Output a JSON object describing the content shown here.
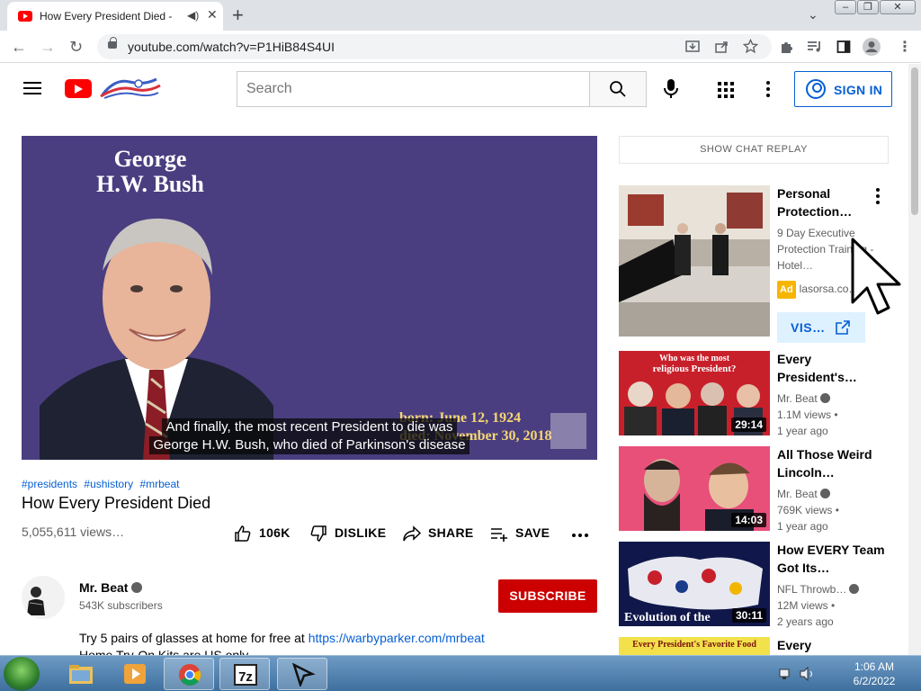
{
  "browser": {
    "tab_title": "How Every President Died - ",
    "new_tab": "+",
    "tab_close": "✕",
    "url": "youtube.com/watch?v=P1HiB84S4UI"
  },
  "header": {
    "search_placeholder": "Search",
    "sign_in_label": "SIGN IN"
  },
  "player": {
    "on_screen_title_line1": "George",
    "on_screen_title_line2": "H.W. Bush",
    "born": "born: June 12, 1924",
    "died": "died: November 30, 2018",
    "caption_line1": "And finally, the most recent President to die was",
    "caption_line2": "George H.W. Bush, who died of Parkinson's disease"
  },
  "video": {
    "hashtags": [
      "#presidents",
      "#ushistory",
      "#mrbeat"
    ],
    "title": "How Every President Died",
    "views": "5,055,611 views…",
    "like_count": "106K",
    "dislike_label": "DISLIKE",
    "share_label": "SHARE",
    "save_label": "SAVE"
  },
  "channel": {
    "name": "Mr. Beat",
    "subscribers": "543K subscribers",
    "subscribe_label": "SUBSCRIBE",
    "description_line1_text": "Try 5 pairs of glasses at home for free at ",
    "description_line1_link": "https://warbyparker.com/mrbeat",
    "description_line2": "Home Try-On Kits are US only"
  },
  "sidebar": {
    "chat_replay": "SHOW CHAT REPLAY",
    "ad": {
      "title": "Personal Protection…",
      "description": "9 Day Executive Protection Training - Hotel…",
      "badge": "Ad",
      "domain": "lasorsa.co…",
      "visit_label": "VIS…"
    },
    "items": [
      {
        "title": "Every President's…",
        "channel": "Mr. Beat",
        "views": "1.1M views •",
        "age": "1 year ago",
        "duration": "29:14",
        "thumb_text": "Who was the most religious President?"
      },
      {
        "title": "All Those Weird Lincoln…",
        "channel": "Mr. Beat",
        "views": "769K views •",
        "age": "1 year ago",
        "duration": "14:03"
      },
      {
        "title": "How EVERY Team Got Its…",
        "channel": "NFL Throwb…",
        "views": "12M views •",
        "age": "2 years ago",
        "duration": "30:11",
        "thumb_text": "Evolution of the"
      },
      {
        "title": "Every",
        "thumb_text": "Every President's Favorite Food"
      }
    ]
  },
  "taskbar": {
    "time": "1:06 AM",
    "date": "6/2/2022"
  },
  "colors": {
    "youtube_red": "#ff0000",
    "subscribe_red": "#cc0000",
    "link_blue": "#065fd4",
    "player_bg": "#4a3e80",
    "ad_badge": "#f7b500"
  }
}
